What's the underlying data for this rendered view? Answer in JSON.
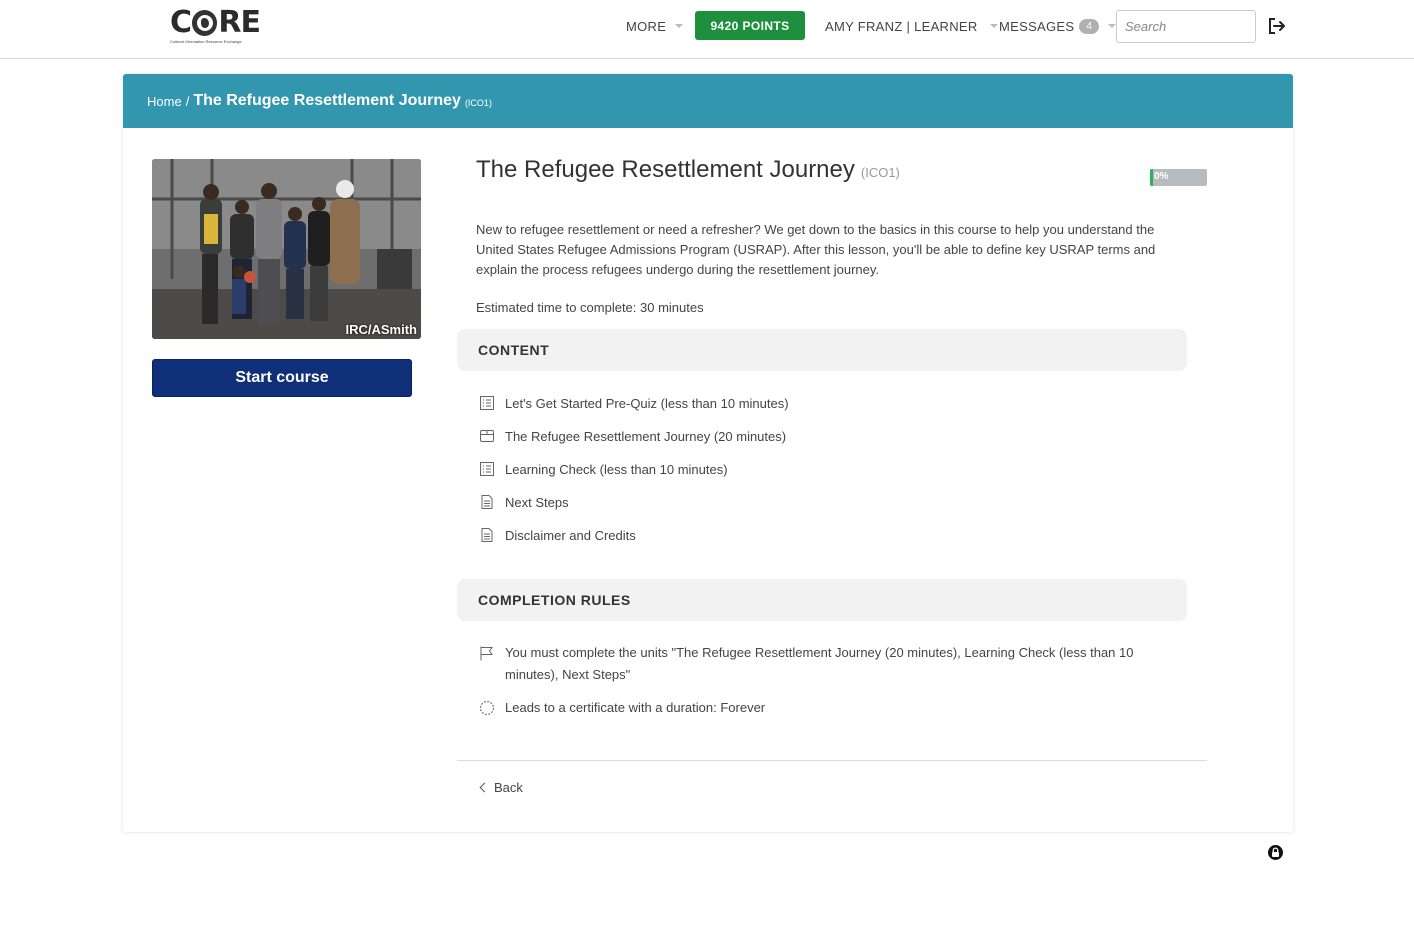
{
  "brand": {
    "logo_word": "CORE",
    "logo_tagline": "Cultural Orientation Resource Exchange"
  },
  "nav": {
    "more_label": "MORE",
    "points_label": "9420 POINTS",
    "user_label": "AMY FRANZ | LEARNER",
    "messages_label": "MESSAGES",
    "messages_count": "4",
    "search_placeholder": "Search"
  },
  "breadcrumb": {
    "home": "Home",
    "separator": "/",
    "title": "The Refugee Resettlement Journey",
    "code": "(ICO1)"
  },
  "course": {
    "title": "The Refugee Resettlement Journey",
    "code": "(ICO1)",
    "image_credit": "IRC/ASmith",
    "start_label": "Start course",
    "progress_percent": 0,
    "progress_label": "0%",
    "description": "New to refugee resettlement or need a refresher? We get down to the basics in this course to help you understand the United States Refugee Admissions Program (USRAP). After this lesson, you'll be able to define key USRAP terms and explain the process refugees undergo during the resettlement journey.",
    "estimated_time": "Estimated time to complete: 30 minutes"
  },
  "content": {
    "heading": "CONTENT",
    "units": [
      {
        "label": "Let's Get Started Pre-Quiz (less than 10 minutes)",
        "icon": "quiz-list-icon"
      },
      {
        "label": "The Refugee Resettlement Journey (20 minutes)",
        "icon": "package-box-icon"
      },
      {
        "label": "Learning Check (less than 10 minutes)",
        "icon": "quiz-list-icon"
      },
      {
        "label": "Next Steps",
        "icon": "document-icon"
      },
      {
        "label": "Disclaimer and Credits",
        "icon": "document-icon"
      }
    ]
  },
  "completion": {
    "heading": "COMPLETION RULES",
    "rules": [
      {
        "text": "You must complete the units \"The Refugee Resettlement Journey (20 minutes), Learning Check (less than 10 minutes), Next Steps\"",
        "icon": "flag-icon"
      },
      {
        "text": "Leads to a certificate with a duration: Forever",
        "icon": "certificate-seal-icon"
      }
    ]
  },
  "footer": {
    "back_label": "Back"
  },
  "colors": {
    "banner": "#3196ae",
    "points": "#1e8f3d",
    "start_button": "#0f2f78",
    "progress_fill": "#26b35a"
  }
}
